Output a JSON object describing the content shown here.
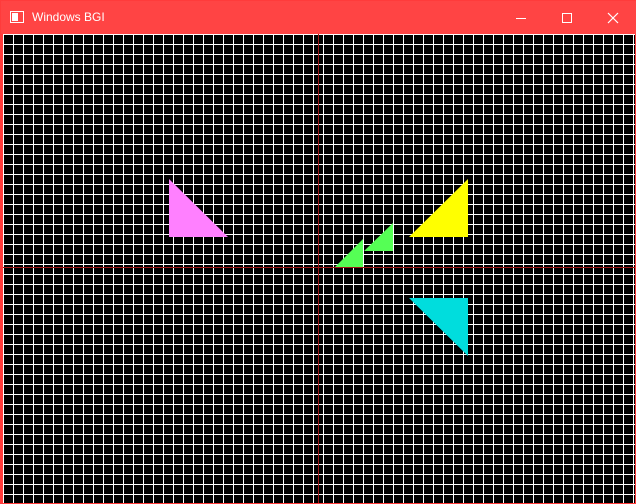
{
  "window": {
    "title": "Windows BGI",
    "controls": {
      "minimize": "minimize-icon",
      "maximize": "maximize-icon",
      "close": "close-icon"
    }
  },
  "colors": {
    "titlebar": "#ff4444",
    "background": "#000000",
    "grid": "#ffffff",
    "axis": "#a01818",
    "triangle_magenta": "#ff80ff",
    "triangle_green": "#55ff55",
    "triangle_yellow": "#ffff00",
    "triangle_cyan": "#00dddd"
  }
}
